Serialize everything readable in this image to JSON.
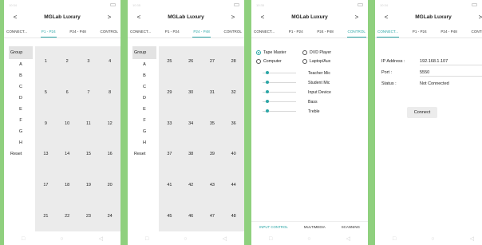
{
  "app_title": "MGLab Luxury",
  "status": {
    "screen1_time": "10:34",
    "screen2_time": "10:35",
    "screen3_time": "10:35",
    "screen4_time": "10:34"
  },
  "nav": {
    "back": "<",
    "forward": ">",
    "bottom_back": "◁",
    "bottom_home": "○",
    "bottom_recents": "□"
  },
  "tabs": [
    "CONNECT...",
    "P1 - P24",
    "P24 - P48",
    "CONTROL"
  ],
  "groups": {
    "header": "Group",
    "letters": [
      "A",
      "B",
      "C",
      "D",
      "E",
      "F",
      "G",
      "H"
    ],
    "reset": "Reset"
  },
  "presets_page1": [
    [
      "1",
      "2",
      "3",
      "4"
    ],
    [
      "5",
      "6",
      "7",
      "8"
    ],
    [
      "9",
      "10",
      "11",
      "12"
    ],
    [
      "13",
      "14",
      "15",
      "16"
    ],
    [
      "17",
      "18",
      "19",
      "20"
    ],
    [
      "21",
      "22",
      "23",
      "24"
    ]
  ],
  "presets_page2": [
    [
      "25",
      "26",
      "27",
      "28"
    ],
    [
      "29",
      "30",
      "31",
      "32"
    ],
    [
      "33",
      "34",
      "35",
      "36"
    ],
    [
      "37",
      "38",
      "39",
      "40"
    ],
    [
      "41",
      "42",
      "43",
      "44"
    ],
    [
      "45",
      "46",
      "47",
      "48"
    ]
  ],
  "control": {
    "sources": [
      {
        "label": "Tape Master",
        "selected": true
      },
      {
        "label": "DVD Player",
        "selected": false
      },
      {
        "label": "Computer",
        "selected": false
      },
      {
        "label": "Laptop/Aux",
        "selected": false
      }
    ],
    "sliders": [
      {
        "label": "Teacher Mic",
        "level": 0.1
      },
      {
        "label": "Student Mic",
        "level": 0.1
      },
      {
        "label": "Input Device",
        "level": 0.1
      },
      {
        "label": "Bass",
        "level": 0.1
      },
      {
        "label": "Treble",
        "level": 0.1
      }
    ],
    "bottom_tabs": [
      "INPUT CONTROL",
      "MULTIMEDIA",
      "SCANNING"
    ]
  },
  "connect_form": {
    "ip_label": "IP Address :",
    "ip_value": "192.168.1.107",
    "port_label": "Port :",
    "port_value": "5550",
    "status_label": "Status :",
    "status_value": "Not Connected",
    "connect_button": "Connect"
  },
  "colors": {
    "accent": "#2aa6a6",
    "background": "#8fd07e",
    "cell_bg": "#ebebeb"
  }
}
